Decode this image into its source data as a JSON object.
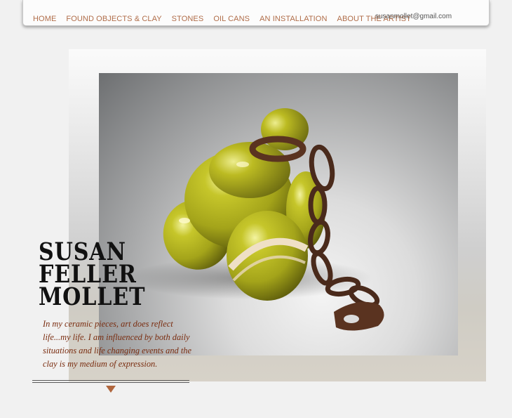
{
  "nav": {
    "items": [
      {
        "label": "HOME"
      },
      {
        "label": "FOUND OBJECTS & CLAY"
      },
      {
        "label": "STONES"
      },
      {
        "label": "OIL CANS"
      },
      {
        "label": "AN INSTALLATION"
      },
      {
        "label": "ABOUT THE ARTIST"
      }
    ],
    "email": "susanmollet@gmail.com"
  },
  "hero": {
    "name_lines": [
      "SUSAN",
      "FELLER",
      "MOLLET"
    ],
    "intro": "In my ceramic pieces, art does reflect life...my life. I am influenced by both daily situations and life changing events and the clay is my medium of expression."
  },
  "colors": {
    "nav_link": "#b06d49",
    "intro_text": "#7a2d10",
    "arrow": "#b0663d",
    "ceramic_glaze": "#b4b21a",
    "rust": "#5a3320"
  },
  "icons": {
    "scroll": "down-arrow-icon"
  }
}
